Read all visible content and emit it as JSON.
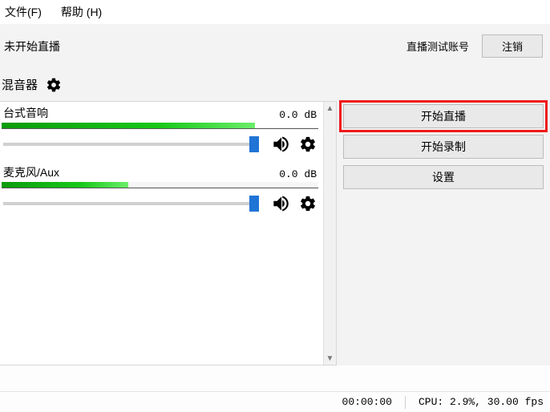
{
  "menu": {
    "file": "文件(F)",
    "help": "帮助 (H)"
  },
  "status": {
    "not_started": "未开始直播",
    "account_label": "直播测试账号",
    "logout": "注销"
  },
  "mixer": {
    "title": "混音器",
    "items": [
      {
        "name": "台式音响",
        "level": "0.0 dB"
      },
      {
        "name": "麦克风/Aux",
        "level": "0.0 dB"
      }
    ]
  },
  "controls": {
    "start_stream": "开始直播",
    "start_record": "开始录制",
    "settings": "设置"
  },
  "footer": {
    "time": "00:00:00",
    "cpu": "CPU: 2.9%, 30.00 fps"
  }
}
